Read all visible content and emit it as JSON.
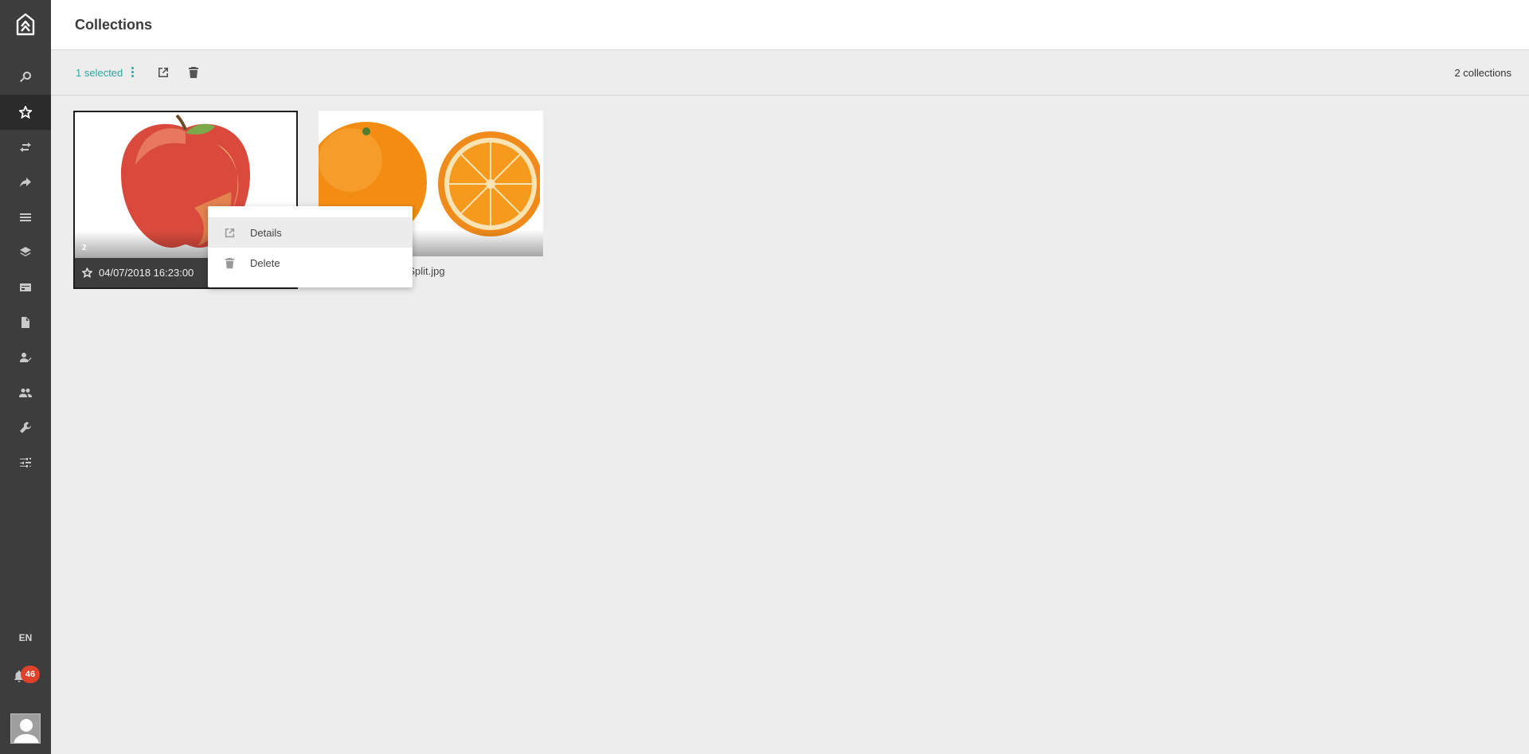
{
  "header": {
    "title": "Collections"
  },
  "toolbar": {
    "selected_label": "1 selected",
    "count_label": "2 collections"
  },
  "sidebar": {
    "items": [
      {
        "icon": "search-icon",
        "active": false
      },
      {
        "icon": "star-icon",
        "active": true
      },
      {
        "icon": "swap-icon",
        "active": false
      },
      {
        "icon": "share-icon",
        "active": false
      },
      {
        "icon": "list-icon",
        "active": false
      },
      {
        "icon": "layers-icon",
        "active": false
      },
      {
        "icon": "card-icon",
        "active": false
      },
      {
        "icon": "document-icon",
        "active": false
      },
      {
        "icon": "user-check-icon",
        "active": false
      },
      {
        "icon": "users-icon",
        "active": false
      },
      {
        "icon": "wrench-icon",
        "active": false
      },
      {
        "icon": "sliders-icon",
        "active": false
      }
    ],
    "language": "EN",
    "notification_count": "46"
  },
  "collections": [
    {
      "name": "04/07/2018 16:23:00",
      "item_count": "2",
      "selected": true,
      "thumb": "apple"
    },
    {
      "name": "-Split.jpg",
      "selected": false,
      "thumb": "orange"
    }
  ],
  "context_menu": {
    "items": [
      {
        "label": "Details",
        "icon": "open-external-icon"
      },
      {
        "label": "Delete",
        "icon": "trash-icon"
      }
    ]
  },
  "colors": {
    "sidebar_bg": "#3d3d3d",
    "accent": "#2aa8a1",
    "badge": "#e0412b",
    "content_bg": "#ededed"
  }
}
